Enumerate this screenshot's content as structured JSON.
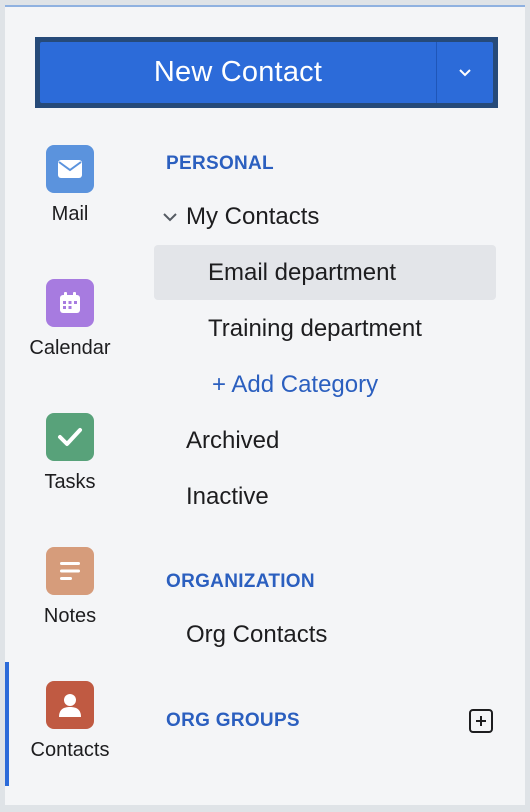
{
  "new_contact": {
    "label": "New Contact",
    "accent": "#2c6bd9"
  },
  "rail": {
    "items": [
      {
        "label": "Mail",
        "icon": "mail-icon",
        "color": "#5b93dd"
      },
      {
        "label": "Calendar",
        "icon": "calendar-icon",
        "color": "#a77be0"
      },
      {
        "label": "Tasks",
        "icon": "check-icon",
        "color": "#58a27a"
      },
      {
        "label": "Notes",
        "icon": "notes-icon",
        "color": "#d69c7b"
      },
      {
        "label": "Contacts",
        "icon": "person-icon",
        "color": "#c05a42",
        "active": true
      }
    ]
  },
  "tree": {
    "personal_heading": "PERSONAL",
    "my_contacts": "My Contacts",
    "categories": [
      "Email department",
      "Training department"
    ],
    "selected_category": "Email department",
    "add_category": "+ Add Category",
    "archived": "Archived",
    "inactive": "Inactive",
    "organization_heading": "ORGANIZATION",
    "org_contacts": "Org Contacts",
    "org_groups_heading": "ORG GROUPS"
  }
}
